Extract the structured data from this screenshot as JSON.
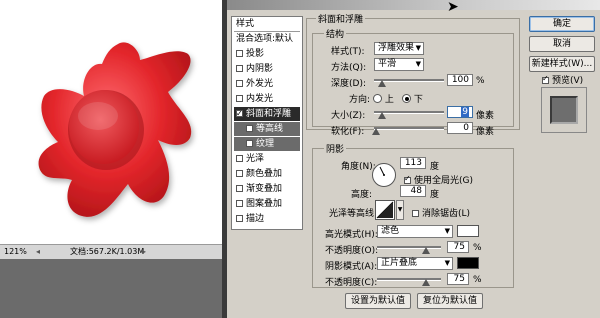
{
  "canvas": {
    "status_zoom": "121%",
    "status_doc": "文档:567.2K/1.03M",
    "shape_color": "#e3262b"
  },
  "dialog": {
    "ok_label": "确定",
    "cancel_label": "取消",
    "new_style_label": "新建样式(W)...",
    "preview_label": "预览(V)",
    "preview_checked": true
  },
  "styles_list": {
    "header": "样式",
    "items": [
      {
        "label": "混合选项:默认",
        "checked": false,
        "state": "head"
      },
      {
        "label": "投影",
        "checked": false
      },
      {
        "label": "内阴影",
        "checked": false
      },
      {
        "label": "外发光",
        "checked": false
      },
      {
        "label": "内发光",
        "checked": false
      },
      {
        "label": "斜面和浮雕",
        "checked": true,
        "state": "selected"
      },
      {
        "label": "等高线",
        "checked": false,
        "state": "sub"
      },
      {
        "label": "纹理",
        "checked": false,
        "state": "sub"
      },
      {
        "label": "光泽",
        "checked": false
      },
      {
        "label": "颜色叠加",
        "checked": false
      },
      {
        "label": "渐变叠加",
        "checked": false
      },
      {
        "label": "图案叠加",
        "checked": false
      },
      {
        "label": "描边",
        "checked": false
      }
    ]
  },
  "bevel": {
    "section_title": "斜面和浮雕",
    "structure_title": "结构",
    "style_label": "样式(T):",
    "style_value": "浮雕效果",
    "method_label": "方法(Q):",
    "method_value": "平滑",
    "depth_label": "深度(D):",
    "depth_value": "100",
    "depth_unit": "%",
    "direction_label": "方向:",
    "direction_up": "上",
    "direction_down": "下",
    "direction_selected": "down",
    "size_label": "大小(Z):",
    "size_value": "9",
    "size_unit": "像素",
    "soften_label": "软化(F):",
    "soften_value": "0",
    "soften_unit": "像素",
    "shading_title": "阴影",
    "angle_label": "角度(N):",
    "angle_value": "113",
    "angle_unit": "度",
    "global_light_label": "使用全局光(G)",
    "global_light_checked": true,
    "altitude_label": "高度:",
    "altitude_value": "48",
    "altitude_unit": "度",
    "gloss_contour_label": "光泽等高线:",
    "antialias_label": "消除锯齿(L)",
    "highlight_mode_label": "高光模式(H):",
    "highlight_mode_value": "滤色",
    "highlight_color": "#ffffff",
    "highlight_opacity_label": "不透明度(O):",
    "highlight_opacity_value": "75",
    "highlight_opacity_unit": "%",
    "shadow_mode_label": "阴影模式(A):",
    "shadow_mode_value": "正片叠底",
    "shadow_color": "#000000",
    "shadow_opacity_label": "不透明度(C):",
    "shadow_opacity_value": "75",
    "shadow_opacity_unit": "%",
    "set_default_label": "设置为默认值",
    "reset_default_label": "复位为默认值"
  }
}
